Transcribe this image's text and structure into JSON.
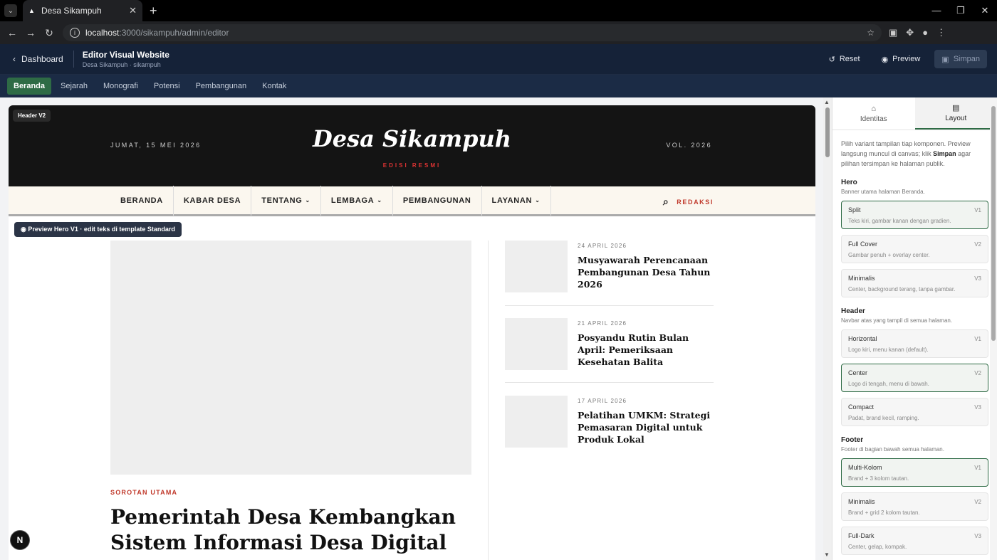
{
  "browser": {
    "tab_title": "Desa Sikampuh",
    "url_host": "localhost",
    "url_path": ":3000/sikampuh/admin/editor"
  },
  "app": {
    "back_label": "Dashboard",
    "title": "Editor Visual Website",
    "subtitle": "Desa Sikampuh · sikampuh",
    "reset_label": "Reset",
    "preview_label": "Preview",
    "save_label": "Simpan"
  },
  "page_tabs": [
    "Beranda",
    "Sejarah",
    "Monografi",
    "Potensi",
    "Pembangunan",
    "Kontak"
  ],
  "site": {
    "badge": "Header V2",
    "date": "JUMAT, 15 MEI 2026",
    "brand": "Desa Sikampuh",
    "edition": "EDISI RESMI",
    "vol": "VOL. 2026",
    "nav": [
      {
        "label": "BERANDA",
        "dd": ""
      },
      {
        "label": "KABAR DESA",
        "dd": ""
      },
      {
        "label": "TENTANG",
        "dd": "⌄"
      },
      {
        "label": "LEMBAGA",
        "dd": "⌄"
      },
      {
        "label": "PEMBANGUNAN",
        "dd": ""
      },
      {
        "label": "LAYANAN",
        "dd": "⌄"
      }
    ],
    "search_label": "REDAKSI",
    "preview_note": "Preview Hero V1 · edit teks di template Standard",
    "kicker": "SOROTAN UTAMA",
    "headline": "Pemerintah Desa Kembangkan Sistem Informasi Desa Digital",
    "news": [
      {
        "date": "24 APRIL 2026",
        "title": "Musyawarah Perencanaan Pembangunan Desa Tahun 2026"
      },
      {
        "date": "21 APRIL 2026",
        "title": "Posyandu Rutin Bulan April: Pemeriksaan Kesehatan Balita"
      },
      {
        "date": "17 APRIL 2026",
        "title": "Pelatihan UMKM: Strategi Pemasaran Digital untuk Produk Lokal"
      }
    ],
    "fab": "N"
  },
  "panel": {
    "tab_identity": "Identitas",
    "tab_layout": "Layout",
    "intro_a": "Pilih variant tampilan tiap komponen. Preview langsung muncul di canvas; klik ",
    "intro_b": "Simpan",
    "intro_c": " agar pilihan tersimpan ke halaman publik.",
    "sections": [
      {
        "title": "Hero",
        "desc": "Banner utama halaman Beranda.",
        "options": [
          {
            "name": "Split",
            "ver": "V1",
            "desc": "Teks kiri, gambar kanan dengan gradien.",
            "selected": true
          },
          {
            "name": "Full Cover",
            "ver": "V2",
            "desc": "Gambar penuh + overlay center.",
            "selected": false
          },
          {
            "name": "Minimalis",
            "ver": "V3",
            "desc": "Center, background terang, tanpa gambar.",
            "selected": false
          }
        ]
      },
      {
        "title": "Header",
        "desc": "Navbar atas yang tampil di semua halaman.",
        "options": [
          {
            "name": "Horizontal",
            "ver": "V1",
            "desc": "Logo kiri, menu kanan (default).",
            "selected": false
          },
          {
            "name": "Center",
            "ver": "V2",
            "desc": "Logo di tengah, menu di bawah.",
            "selected": true
          },
          {
            "name": "Compact",
            "ver": "V3",
            "desc": "Padat, brand kecil, ramping.",
            "selected": false
          }
        ]
      },
      {
        "title": "Footer",
        "desc": "Footer di bagian bawah semua halaman.",
        "options": [
          {
            "name": "Multi-Kolom",
            "ver": "V1",
            "desc": "Brand + 3 kolom tautan.",
            "selected": true
          },
          {
            "name": "Minimalis",
            "ver": "V2",
            "desc": "Brand + grid 2 kolom tautan.",
            "selected": false
          },
          {
            "name": "Full-Dark",
            "ver": "V3",
            "desc": "Center, gelap, kompak.",
            "selected": false
          }
        ]
      }
    ]
  },
  "colors": {
    "accent": "#2e6b45",
    "header_bg": "#152238",
    "site_red": "#c0392b"
  }
}
